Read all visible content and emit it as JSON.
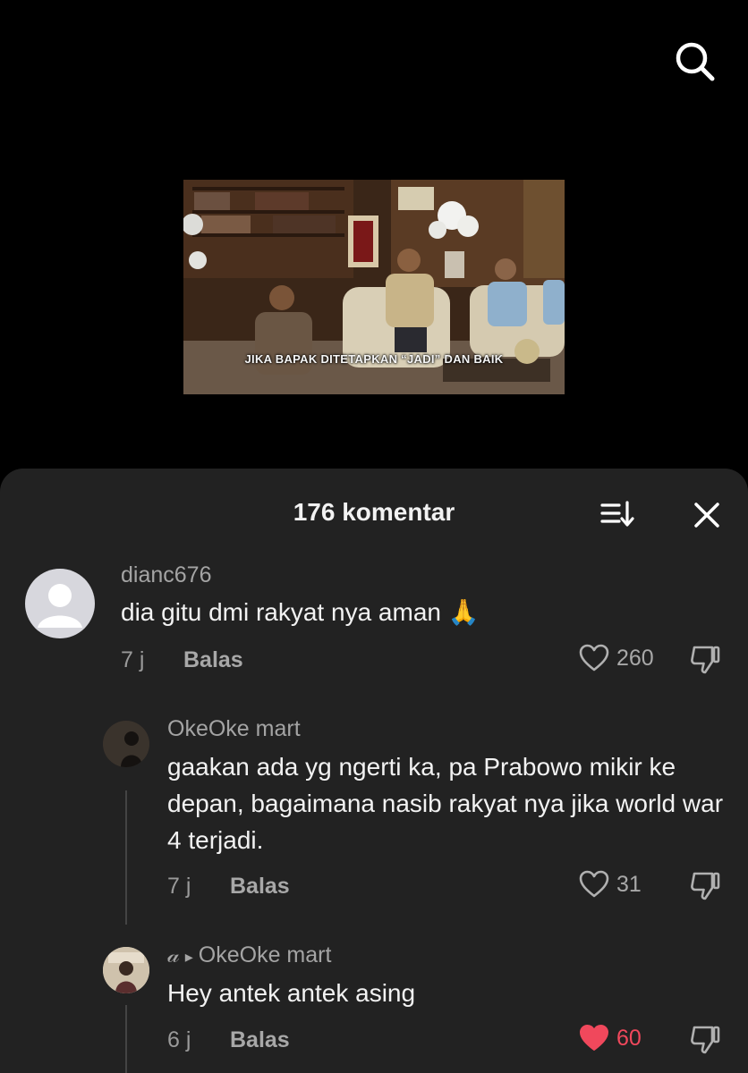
{
  "icons": {
    "search": "search-icon",
    "sort": "sort-icon",
    "close": "close-icon",
    "heart": "heart-icon",
    "dislike": "thumb-down-icon"
  },
  "colors": {
    "sheet_bg": "#222222",
    "liked": "#f0485c",
    "muted_text": "#a4a4a4"
  },
  "video": {
    "caption": "JIKA BAPAK DITETAPKAN “JADI” DAN BAIK"
  },
  "comments_sheet": {
    "title": "176 komentar",
    "comments": [
      {
        "username": "dianc676",
        "text": "dia gitu dmi rakyat nya aman 🙏",
        "time": "7 j",
        "reply_label": "Balas",
        "likes": "260",
        "liked": false
      },
      {
        "username": "OkeOke mart",
        "text": "gaakan ada yg ngerti ka, pa Prabowo mikir ke depan, bagaimana nasib rakyat nya jika world war 4 terjadi.",
        "time": "7 j",
        "reply_label": "Balas",
        "likes": "31",
        "liked": false
      },
      {
        "username_prefix": "𝒶",
        "reply_to": "OkeOke mart",
        "text": "Hey antek antek asing",
        "time": "6 j",
        "reply_label": "Balas",
        "likes": "60",
        "liked": true
      }
    ]
  }
}
